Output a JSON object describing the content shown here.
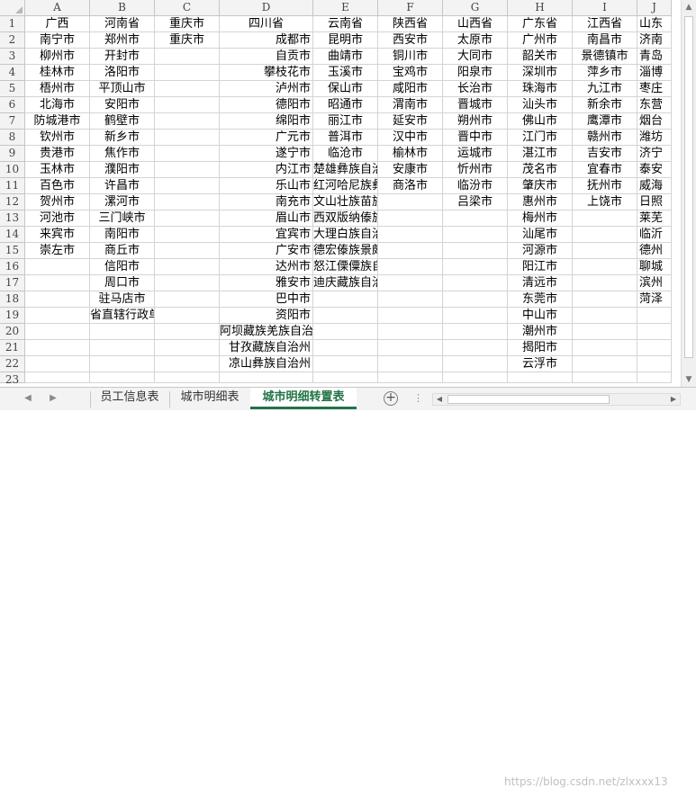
{
  "spreadsheet": {
    "column_headers": [
      "A",
      "B",
      "C",
      "D",
      "E",
      "F",
      "G",
      "H",
      "I",
      "J"
    ],
    "row_numbers": [
      "1",
      "2",
      "3",
      "4",
      "5",
      "6",
      "7",
      "8",
      "9",
      "10",
      "11",
      "12",
      "13",
      "14",
      "15",
      "16",
      "17",
      "18",
      "19",
      "20",
      "21",
      "22",
      "23"
    ],
    "header_row": [
      "广西",
      "河南省",
      "重庆市",
      "四川省",
      "云南省",
      "陕西省",
      "山西省",
      "广东省",
      "江西省",
      "山东"
    ],
    "columns": {
      "A": [
        "南宁市",
        "柳州市",
        "桂林市",
        "梧州市",
        "北海市",
        "防城港市",
        "钦州市",
        "贵港市",
        "玉林市",
        "百色市",
        "贺州市",
        "河池市",
        "来宾市",
        "崇左市"
      ],
      "B": [
        "郑州市",
        "开封市",
        "洛阳市",
        "平顶山市",
        "安阳市",
        "鹤壁市",
        "新乡市",
        "焦作市",
        "濮阳市",
        "许昌市",
        "漯河市",
        "三门峡市",
        "南阳市",
        "商丘市",
        "信阳市",
        "周口市",
        "驻马店市",
        "省直辖行政单位"
      ],
      "C": [
        "重庆市"
      ],
      "D": [
        "成都市",
        "自贡市",
        "攀枝花市",
        "泸州市",
        "德阳市",
        "绵阳市",
        "广元市",
        "遂宁市",
        "内江市",
        "乐山市",
        "南充市",
        "眉山市",
        "宜宾市",
        "广安市",
        "达州市",
        "雅安市",
        "巴中市",
        "资阳市",
        "阿坝藏族羌族自治州",
        "甘孜藏族自治州",
        "凉山彝族自治州"
      ],
      "E": [
        "昆明市",
        "曲靖市",
        "玉溪市",
        "保山市",
        "昭通市",
        "丽江市",
        "普洱市",
        "临沧市",
        "楚雄彝族自治州",
        "红河哈尼族彝族自治州",
        "文山壮族苗族自治州",
        "西双版纳傣族自治州",
        "大理白族自治州",
        "德宏傣族景颇族自治州",
        "怒江傈僳族自治州",
        "迪庆藏族自治州"
      ],
      "F": [
        "西安市",
        "铜川市",
        "宝鸡市",
        "咸阳市",
        "渭南市",
        "延安市",
        "汉中市",
        "榆林市",
        "安康市",
        "商洛市"
      ],
      "G": [
        "太原市",
        "大同市",
        "阳泉市",
        "长治市",
        "晋城市",
        "朔州市",
        "晋中市",
        "运城市",
        "忻州市",
        "临汾市",
        "吕梁市"
      ],
      "H": [
        "广州市",
        "韶关市",
        "深圳市",
        "珠海市",
        "汕头市",
        "佛山市",
        "江门市",
        "湛江市",
        "茂名市",
        "肇庆市",
        "惠州市",
        "梅州市",
        "汕尾市",
        "河源市",
        "阳江市",
        "清远市",
        "东莞市",
        "中山市",
        "潮州市",
        "揭阳市",
        "云浮市"
      ],
      "I": [
        "南昌市",
        "景德镇市",
        "萍乡市",
        "九江市",
        "新余市",
        "鹰潭市",
        "赣州市",
        "吉安市",
        "宜春市",
        "抚州市",
        "上饶市"
      ],
      "J": [
        "济南",
        "青岛",
        "淄博",
        "枣庄",
        "东营",
        "烟台",
        "潍坊",
        "济宁",
        "泰安",
        "威海",
        "日照",
        "莱芜",
        "临沂",
        "德州",
        "聊城",
        "滨州",
        "菏泽"
      ]
    }
  },
  "sheet_tabs": [
    "员工信息表",
    "城市明细表",
    "城市明细转置表"
  ],
  "active_tab": "城市明细转置表",
  "watermark": "https://blog.csdn.net/zlxxxx13",
  "colors": {
    "active_tab": "#217346",
    "grid_line": "#d4d4d4",
    "header_bg": "#f3f3f3"
  }
}
